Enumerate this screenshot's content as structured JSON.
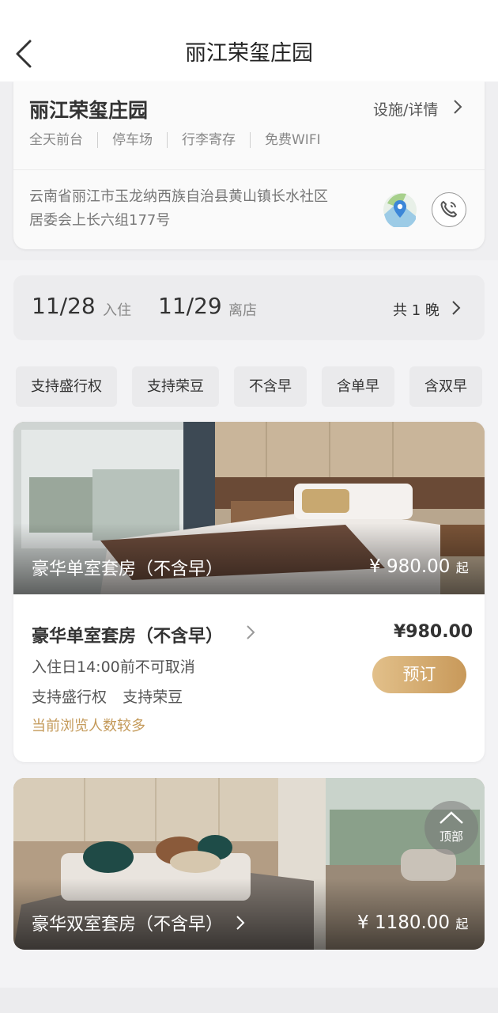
{
  "header": {
    "title": "丽江荣玺庄园"
  },
  "hotel": {
    "name": "丽江荣玺庄园",
    "facility_link": "设施/详情",
    "amenities": [
      "全天前台",
      "停车场",
      "行李寄存",
      "免费WIFI"
    ],
    "address_line1": "云南省丽江市玉龙纳西族自治县黄山镇长水社区",
    "address_line2": "居委会上长六组177号"
  },
  "dates": {
    "checkin_date": "11/28",
    "checkin_label": "入住",
    "checkout_date": "11/29",
    "checkout_label": "离店",
    "nights": "共 1 晚"
  },
  "filters": [
    "支持盛行权",
    "支持荣豆",
    "不含早",
    "含单早",
    "含双早"
  ],
  "rooms": [
    {
      "photo_title": "豪华单室套房（不含早）",
      "photo_price": "¥ 980.00",
      "photo_price_suffix": "起",
      "name": "豪华单室套房（不含早）",
      "price": "¥980.00",
      "cancel_policy": "入住日14:00前不可取消",
      "perks": [
        "支持盛行权",
        "支持荣豆"
      ],
      "hot_note": "当前浏览人数较多",
      "book_label": "预订"
    },
    {
      "photo_title": "豪华双室套房（不含早）",
      "photo_price": "¥ 1180.00",
      "photo_price_suffix": "起"
    }
  ],
  "top_button": {
    "label": "顶部"
  },
  "colors": {
    "accent_gold": "#c49a5a",
    "button_gradient_start": "#e2c08a",
    "button_gradient_end": "#c8995a"
  }
}
